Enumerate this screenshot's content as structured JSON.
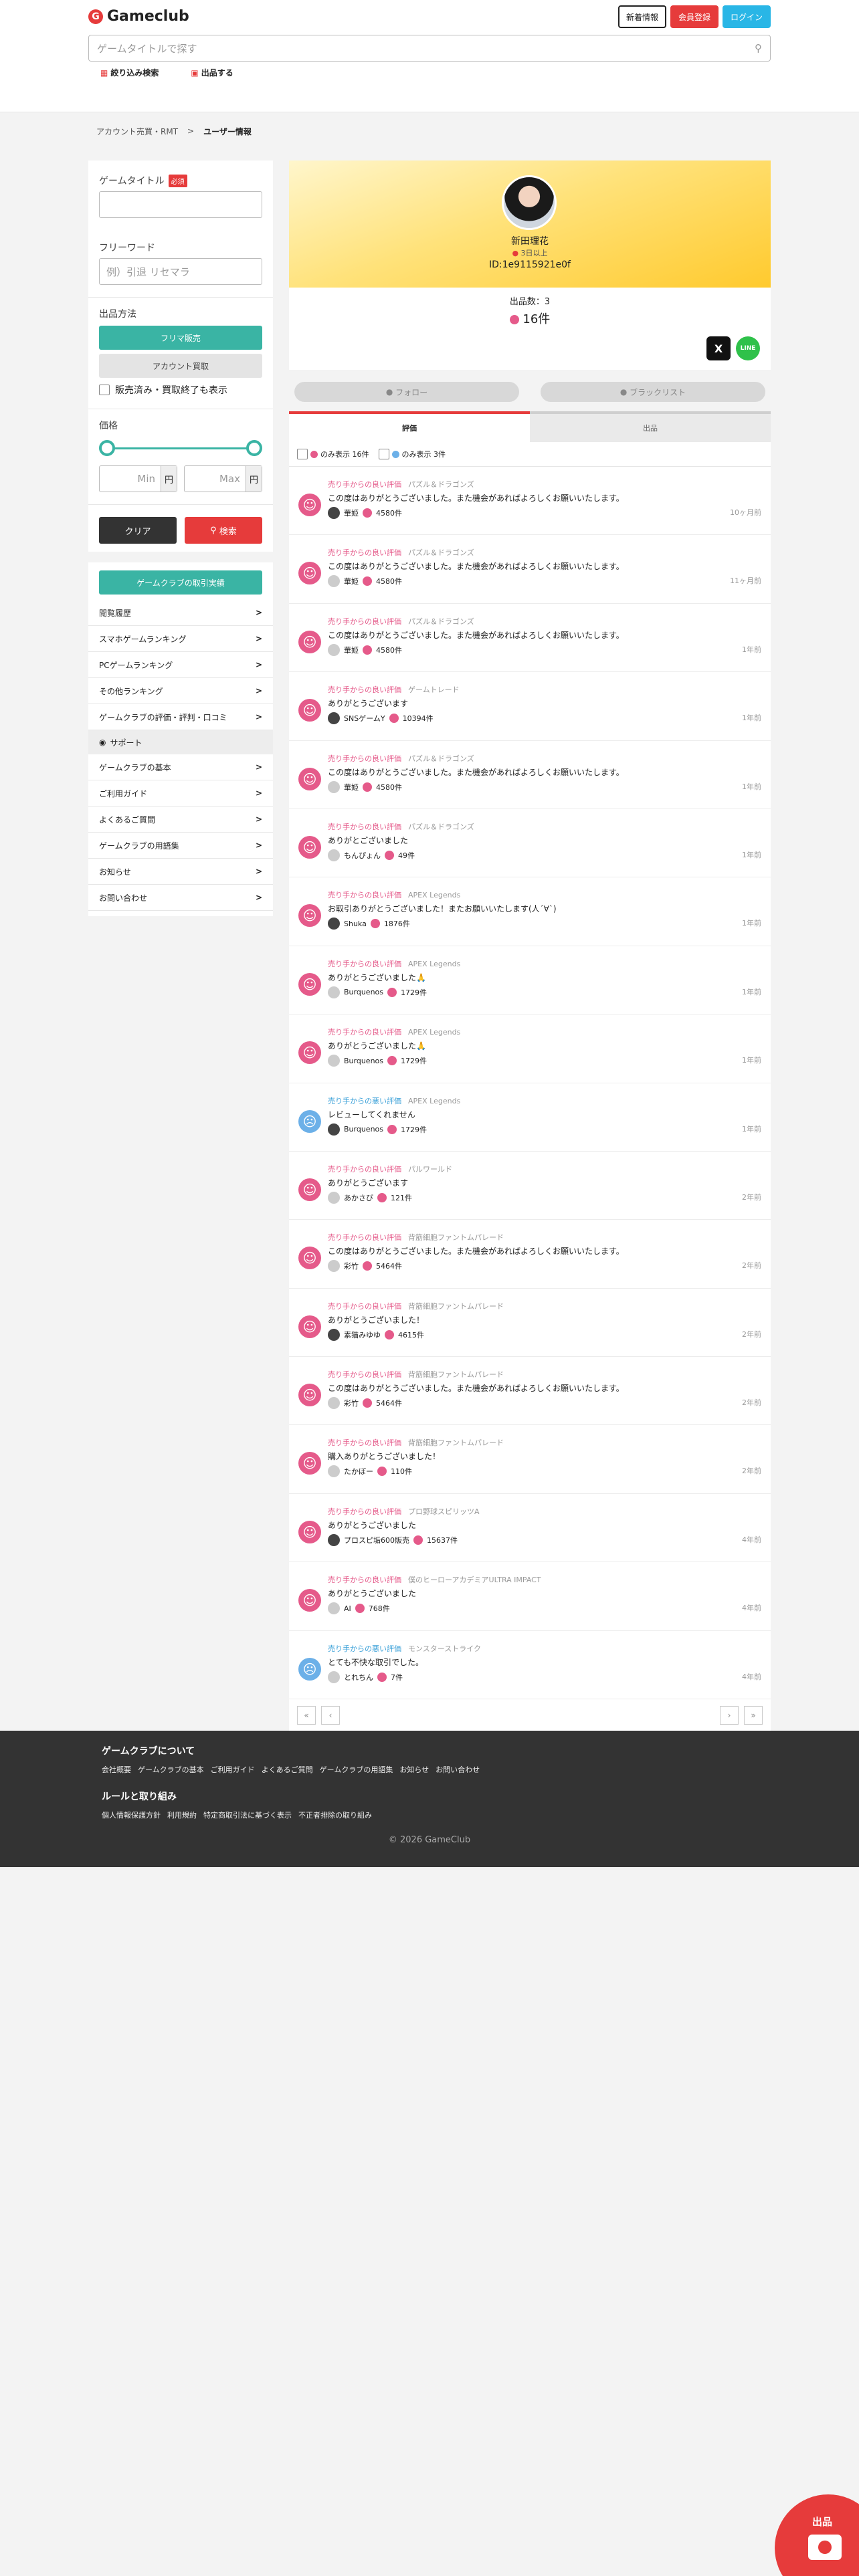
{
  "header": {
    "logo_text": "Gameclub",
    "buttons": [
      "新着情報",
      "会員登録",
      "ログイン"
    ],
    "search_placeholder": "ゲームタイトルで探す",
    "subnav": [
      "絞り込み検索",
      "出品する"
    ]
  },
  "breadcrumb": [
    "アカウント売買・RMT",
    "ユーザー情報"
  ],
  "sidebar": {
    "title_label": "ゲームタイトル",
    "required": "必須",
    "freeword_label": "フリーワード",
    "freeword_placeholder": "例）引退 リセマラ",
    "method_label": "出品方法",
    "method_buttons": [
      "フリマ販売",
      "アカウント買取"
    ],
    "sold_toggle": "販売済み・買取終了も表示",
    "price_label": "価格",
    "price_min": "Min",
    "price_max": "Max",
    "yen": "円",
    "clear": "クリア",
    "search": "検索"
  },
  "menu": {
    "highlight": "ゲームクラブの取引実績",
    "items": [
      "閲覧履歴",
      "スマホゲームランキング",
      "PCゲームランキング",
      "その他ランキング",
      "ゲームクラブの評価・評判・口コミ"
    ],
    "support_label": "サポート",
    "support_items": [
      "ゲームクラブの基本",
      "ご利用ガイド",
      "よくあるご質問",
      "ゲームクラブの用語集",
      "お知らせ",
      "お問い合わせ"
    ]
  },
  "profile": {
    "name": "新田理花",
    "rank": "3日以上",
    "id": "ID:1e9115921e0f",
    "listings": "出品数：3",
    "good_count": "16件",
    "follow": "フォロー",
    "blacklist": "ブラックリスト"
  },
  "tabs": [
    "評価",
    "出品"
  ],
  "filters": [
    "のみ表示 16件",
    "のみ表示 3件"
  ],
  "reviews": [
    {
      "type": "売り手からの良い評価",
      "game": "パズル＆ドラゴンズ",
      "msg": "この度はありがとうございました。また機会があればよろしくお願いいたします。",
      "user": "華姫",
      "count": "4580件",
      "when": "10ヶ月前",
      "bad": false
    },
    {
      "type": "売り手からの良い評価",
      "game": "パズル＆ドラゴンズ",
      "msg": "この度はありがとうございました。また機会があればよろしくお願いいたします。",
      "user": "華姫",
      "count": "4580件",
      "when": "11ヶ月前",
      "bad": false
    },
    {
      "type": "売り手からの良い評価",
      "game": "パズル＆ドラゴンズ",
      "msg": "この度はありがとうございました。また機会があればよろしくお願いいたします。",
      "user": "華姫",
      "count": "4580件",
      "when": "1年前",
      "bad": false
    },
    {
      "type": "売り手からの良い評価",
      "game": "ゲームトレード",
      "msg": "ありがとうございます",
      "user": "SNSゲームY",
      "count": "10394件",
      "when": "1年前",
      "bad": false
    },
    {
      "type": "売り手からの良い評価",
      "game": "パズル＆ドラゴンズ",
      "msg": "この度はありがとうございました。また機会があればよろしくお願いいたします。",
      "user": "華姫",
      "count": "4580件",
      "when": "1年前",
      "bad": false
    },
    {
      "type": "売り手からの良い評価",
      "game": "パズル＆ドラゴンズ",
      "msg": "ありがとございました",
      "user": "もんぴょん",
      "count": "49件",
      "when": "1年前",
      "bad": false
    },
    {
      "type": "売り手からの良い評価",
      "game": "APEX Legends",
      "msg": "お取引ありがとうございました！またお願いいたします(人´∀`)",
      "user": "Shuka",
      "count": "1876件",
      "when": "1年前",
      "bad": false
    },
    {
      "type": "売り手からの良い評価",
      "game": "APEX Legends",
      "msg": "ありがとうございました🙏",
      "user": "Burquenos",
      "count": "1729件",
      "when": "1年前",
      "bad": false
    },
    {
      "type": "売り手からの良い評価",
      "game": "APEX Legends",
      "msg": "ありがとうございました🙏",
      "user": "Burquenos",
      "count": "1729件",
      "when": "1年前",
      "bad": false
    },
    {
      "type": "売り手からの悪い評価",
      "game": "APEX Legends",
      "msg": "レビューしてくれません",
      "user": "Burquenos",
      "count": "1729件",
      "when": "1年前",
      "bad": true
    },
    {
      "type": "売り手からの良い評価",
      "game": "パルワールド",
      "msg": "ありがとうございます",
      "user": "あかさび",
      "count": "121件",
      "when": "2年前",
      "bad": false
    },
    {
      "type": "売り手からの良い評価",
      "game": "背筋細胞ファントムパレード",
      "msg": "この度はありがとうございました。また機会があればよろしくお願いいたします。",
      "user": "彩竹",
      "count": "5464件",
      "when": "2年前",
      "bad": false
    },
    {
      "type": "売り手からの良い評価",
      "game": "背筋細胞ファントムパレード",
      "msg": "ありがとうございました！",
      "user": "素猫みゆゆ",
      "count": "4615件",
      "when": "2年前",
      "bad": false
    },
    {
      "type": "売り手からの良い評価",
      "game": "背筋細胞ファントムパレード",
      "msg": "この度はありがとうございました。また機会があればよろしくお願いいたします。",
      "user": "彩竹",
      "count": "5464件",
      "when": "2年前",
      "bad": false
    },
    {
      "type": "売り手からの良い評価",
      "game": "背筋細胞ファントムパレード",
      "msg": "購入ありがとうございました！",
      "user": "たかぼー",
      "count": "110件",
      "when": "2年前",
      "bad": false
    },
    {
      "type": "売り手からの良い評価",
      "game": "プロ野球スピリッツA",
      "msg": "ありがとうございました",
      "user": "プロスピ垢600販売",
      "count": "15637件",
      "when": "4年前",
      "bad": false
    },
    {
      "type": "売り手からの良い評価",
      "game": "僕のヒーローアカデミアULTRA IMPACT",
      "msg": "ありがとうございました",
      "user": "AI",
      "count": "768件",
      "when": "4年前",
      "bad": false
    },
    {
      "type": "売り手からの悪い評価",
      "game": "モンスターストライク",
      "msg": "とても不快な取引でした。",
      "user": "とれちん",
      "count": "7件",
      "when": "4年前",
      "bad": true
    }
  ],
  "pager": [
    "«",
    "‹",
    "›",
    "»"
  ],
  "footer": {
    "about_title": "ゲームクラブについて",
    "about_links": [
      "会社概要",
      "ゲームクラブの基本",
      "ご利用ガイド",
      "よくあるご質問",
      "ゲームクラブの用語集",
      "お知らせ",
      "お問い合わせ"
    ],
    "rules_title": "ルールと取り組み",
    "rules_links": [
      "個人情報保護方針",
      "利用規約",
      "特定商取引法に基づく表示",
      "不正者排除の取り組み"
    ],
    "copyright": "© 2026 GameClub"
  },
  "fab_label": "出品"
}
